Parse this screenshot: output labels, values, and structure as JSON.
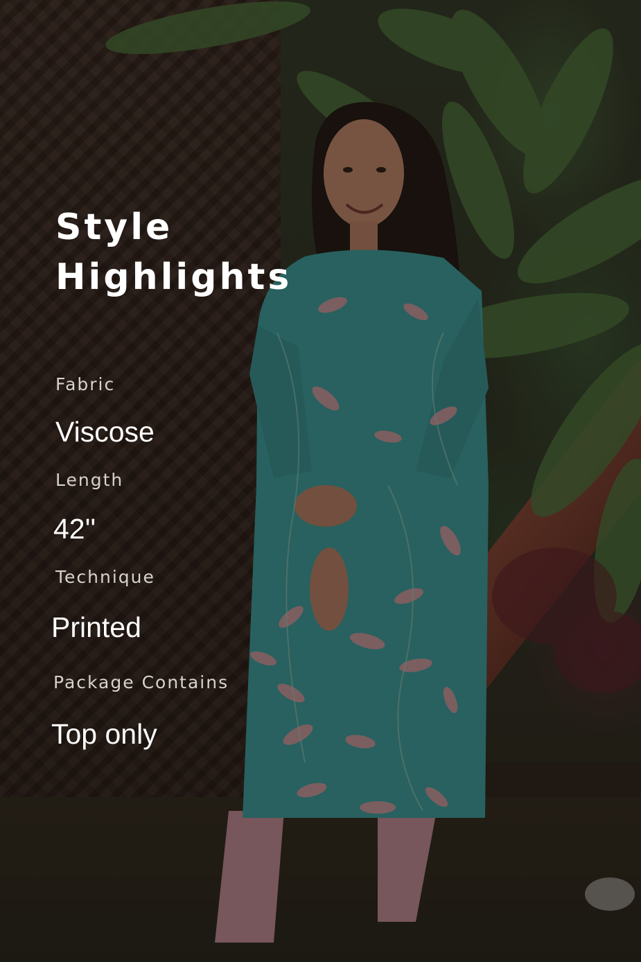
{
  "heading": {
    "line1": "Style",
    "line2": "Highlights"
  },
  "specs": [
    {
      "label": "Fabric",
      "value": "Viscose"
    },
    {
      "label": "Length",
      "value": "42''"
    },
    {
      "label": "Technique",
      "value": "Printed"
    },
    {
      "label": "Package Contains",
      "value": "Top only"
    }
  ],
  "colors": {
    "text": "#ffffff",
    "label_text": "#d8d2cc",
    "kurta": "#3aa7a4",
    "print": "#e0a0a8",
    "leggings": "#d9a6b3",
    "overlay_tint": "#2a211b"
  }
}
